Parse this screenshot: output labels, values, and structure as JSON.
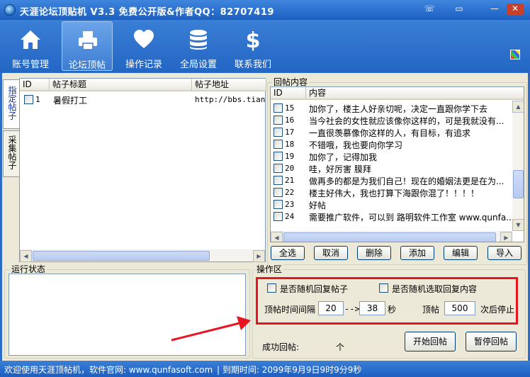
{
  "window": {
    "title": "天涯论坛顶贴机  V3.3  免费公开版&作者QQ：82707419",
    "controls": {
      "chat": "☏",
      "restore": "▭",
      "minimize": "—",
      "close": "✕"
    }
  },
  "toolbar": [
    {
      "label": "账号管理",
      "icon": "house-icon"
    },
    {
      "label": "论坛顶帖",
      "icon": "printer-icon"
    },
    {
      "label": "操作记录",
      "icon": "heart-icon"
    },
    {
      "label": "全局设置",
      "icon": "coin-stack-icon"
    },
    {
      "label": "联系我们",
      "icon": "dollar-icon"
    }
  ],
  "left_tabs": [
    "指定帖子",
    "采集帖子"
  ],
  "post_table": {
    "headers": [
      "ID",
      "帖子标题",
      "帖子地址"
    ],
    "rows": [
      {
        "id": "1",
        "title": "暑假打工",
        "url": "http://bbs.tiany"
      }
    ]
  },
  "reply_content": {
    "title": "回帖内容",
    "headers": [
      "ID",
      "内容"
    ],
    "rows": [
      {
        "id": "15",
        "text": "加你了，楼主人好亲切呢，决定一直跟你学下去"
      },
      {
        "id": "16",
        "text": "当今社会的女性就应该像你这样的，可是我就没有..."
      },
      {
        "id": "17",
        "text": "一直很羡慕像你这样的人，有目标，有追求"
      },
      {
        "id": "18",
        "text": "不错哦，我也要向你学习"
      },
      {
        "id": "19",
        "text": "加你了，记得加我"
      },
      {
        "id": "20",
        "text": "哇，好厉害 膜拜"
      },
      {
        "id": "21",
        "text": "做再多的都是为我们自己！现在的婚姻法更是在为..."
      },
      {
        "id": "22",
        "text": "楼主好伟大，我也打算下海跟你混了！！！！"
      },
      {
        "id": "23",
        "text": "好帖"
      },
      {
        "id": "24",
        "text": "需要推广软件，可以到 路明软件工作室 www.qunfa..."
      }
    ],
    "buttons": [
      "全选",
      "取消",
      "删除",
      "添加",
      "编辑",
      "导入"
    ]
  },
  "run_status": {
    "title": "运行状态"
  },
  "operations": {
    "title": "操作区",
    "random_reply_post": "是否随机回复帖子",
    "random_reply_content": "是否随机选取回复内容",
    "interval_label": "顶帖时间间隔",
    "interval_from": "20",
    "arrow": "-->",
    "interval_to": "38",
    "seconds": "秒",
    "count_label": "顶帖",
    "count_value": "500",
    "stop_after": "次后停止",
    "success_label": "成功回帖:",
    "success_unit": "个",
    "start_button": "开始回帖",
    "pause_button": "暂停回帖"
  },
  "statusbar": {
    "welcome": "欢迎使用天涯顶帖机，软件官网: www.qunfasoft.com",
    "expiry": "| 到期时间: 2099年9月9日9时9分9秒"
  },
  "colors": {
    "titlebar": "#2a6cc8",
    "highlight_frame": "#e8141e",
    "window_bg": "#ece9d8"
  }
}
